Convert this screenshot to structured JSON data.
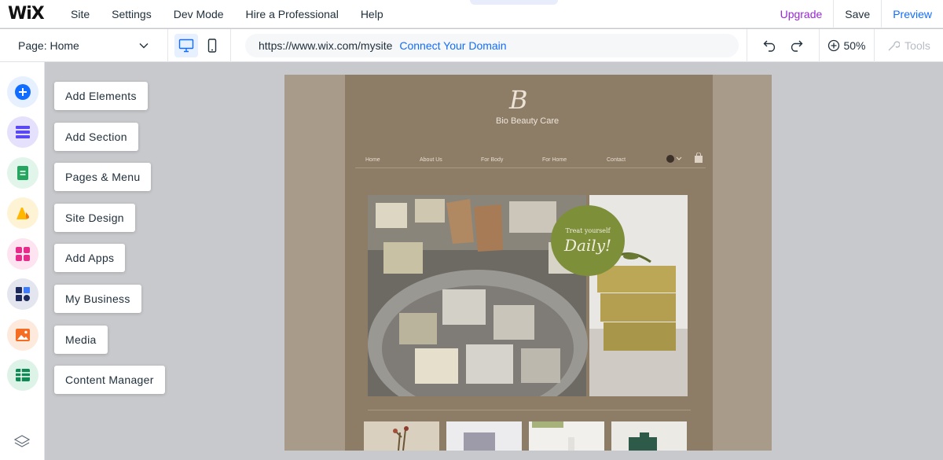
{
  "app": {
    "logo": "WiX"
  },
  "topmenu": [
    "Site",
    "Settings",
    "Dev Mode",
    "Hire a Professional",
    "Help"
  ],
  "topright": {
    "upgrade": "Upgrade",
    "save": "Save",
    "preview": "Preview"
  },
  "toolbar": {
    "page_label": "Page: Home",
    "url": "https://www.wix.com/mysite",
    "connect": "Connect Your Domain",
    "zoom": "50%",
    "tools": "Tools"
  },
  "rail": [
    {
      "icon": "plus-icon",
      "label": "Add Elements",
      "color": "#116dff",
      "bg": "#e7f0ff"
    },
    {
      "icon": "section-icon",
      "label": "Add Section",
      "color": "#5a48f5",
      "bg": "#e5e1fd"
    },
    {
      "icon": "pages-icon",
      "label": "Pages & Menu",
      "color": "#25a55f",
      "bg": "#e2f5ea"
    },
    {
      "icon": "design-icon",
      "label": "Site Design",
      "color": "#ffb700",
      "bg": "#fff3d6"
    },
    {
      "icon": "apps-icon",
      "label": "Add Apps",
      "color": "#e62b8a",
      "bg": "#fde4f0"
    },
    {
      "icon": "business-icon",
      "label": "My Business",
      "color": "#1c2a5c",
      "bg": "#e3e6ef"
    },
    {
      "icon": "media-icon",
      "label": "Media",
      "color": "#f46d22",
      "bg": "#feeadd"
    },
    {
      "icon": "table-icon",
      "label": "Content Manager",
      "color": "#0f8a55",
      "bg": "#def3e8"
    }
  ],
  "site": {
    "logo": "B",
    "name": "Bio Beauty Care",
    "nav": [
      "Home",
      "About Us",
      "For Body",
      "For Home",
      "Contact"
    ],
    "badge_line1": "Treat yourself",
    "badge_line2": "Daily!"
  }
}
